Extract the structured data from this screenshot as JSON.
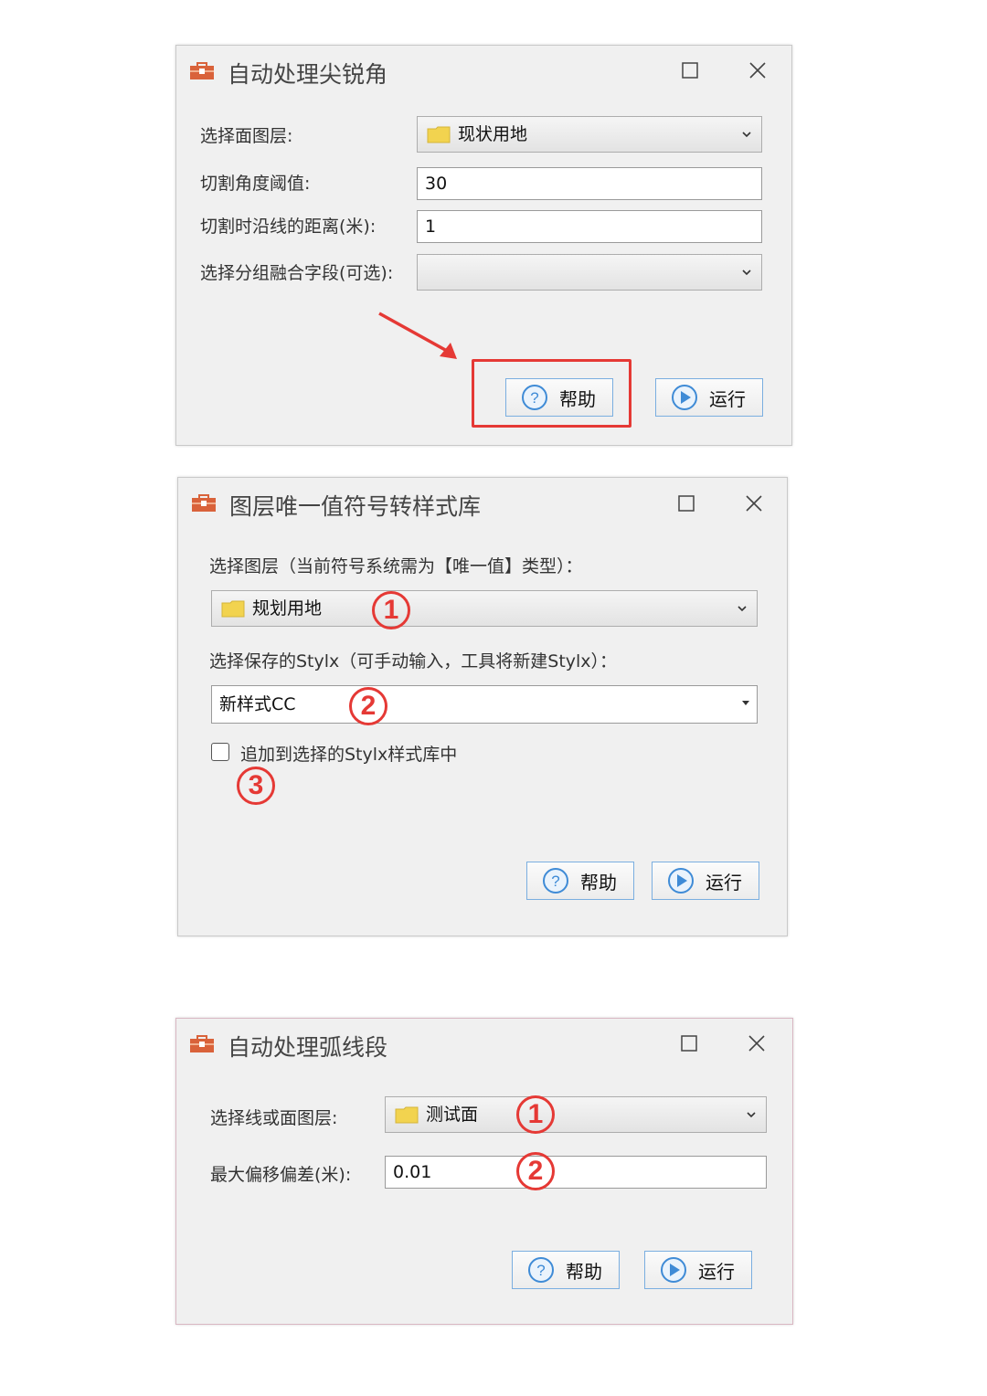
{
  "dialog1": {
    "title": "自动处理尖锐角",
    "fields": [
      {
        "label": "选择面图层:",
        "value": "现状用地"
      },
      {
        "label": "切割角度阈值:",
        "value": "30"
      },
      {
        "label": "切割时沿线的距离(米):",
        "value": "1"
      },
      {
        "label": "选择分组融合字段(可选):",
        "value": ""
      }
    ],
    "help_label": "帮助",
    "run_label": "运行",
    "highlight_color": "#e53935"
  },
  "dialog2": {
    "title": "图层唯一值符号转样式库",
    "layer_label": "选择图层（当前符号系统需为【唯一值】类型）：",
    "layer_value": "规划用地",
    "stylx_label": "选择保存的Stylx（可手动输入，工具将新建Stylx）：",
    "stylx_value": "新样式CC",
    "append_label": "追加到选择的Stylx样式库中",
    "append_checked": false,
    "help_label": "帮助",
    "run_label": "运行",
    "markers": [
      "1",
      "2",
      "3"
    ]
  },
  "dialog3": {
    "title": "自动处理弧线段",
    "fields": [
      {
        "label": "选择线或面图层:",
        "value": "测试面"
      },
      {
        "label": "最大偏移偏差(米):",
        "value": "0.01"
      }
    ],
    "help_label": "帮助",
    "run_label": "运行",
    "markers": [
      "1",
      "2"
    ]
  }
}
